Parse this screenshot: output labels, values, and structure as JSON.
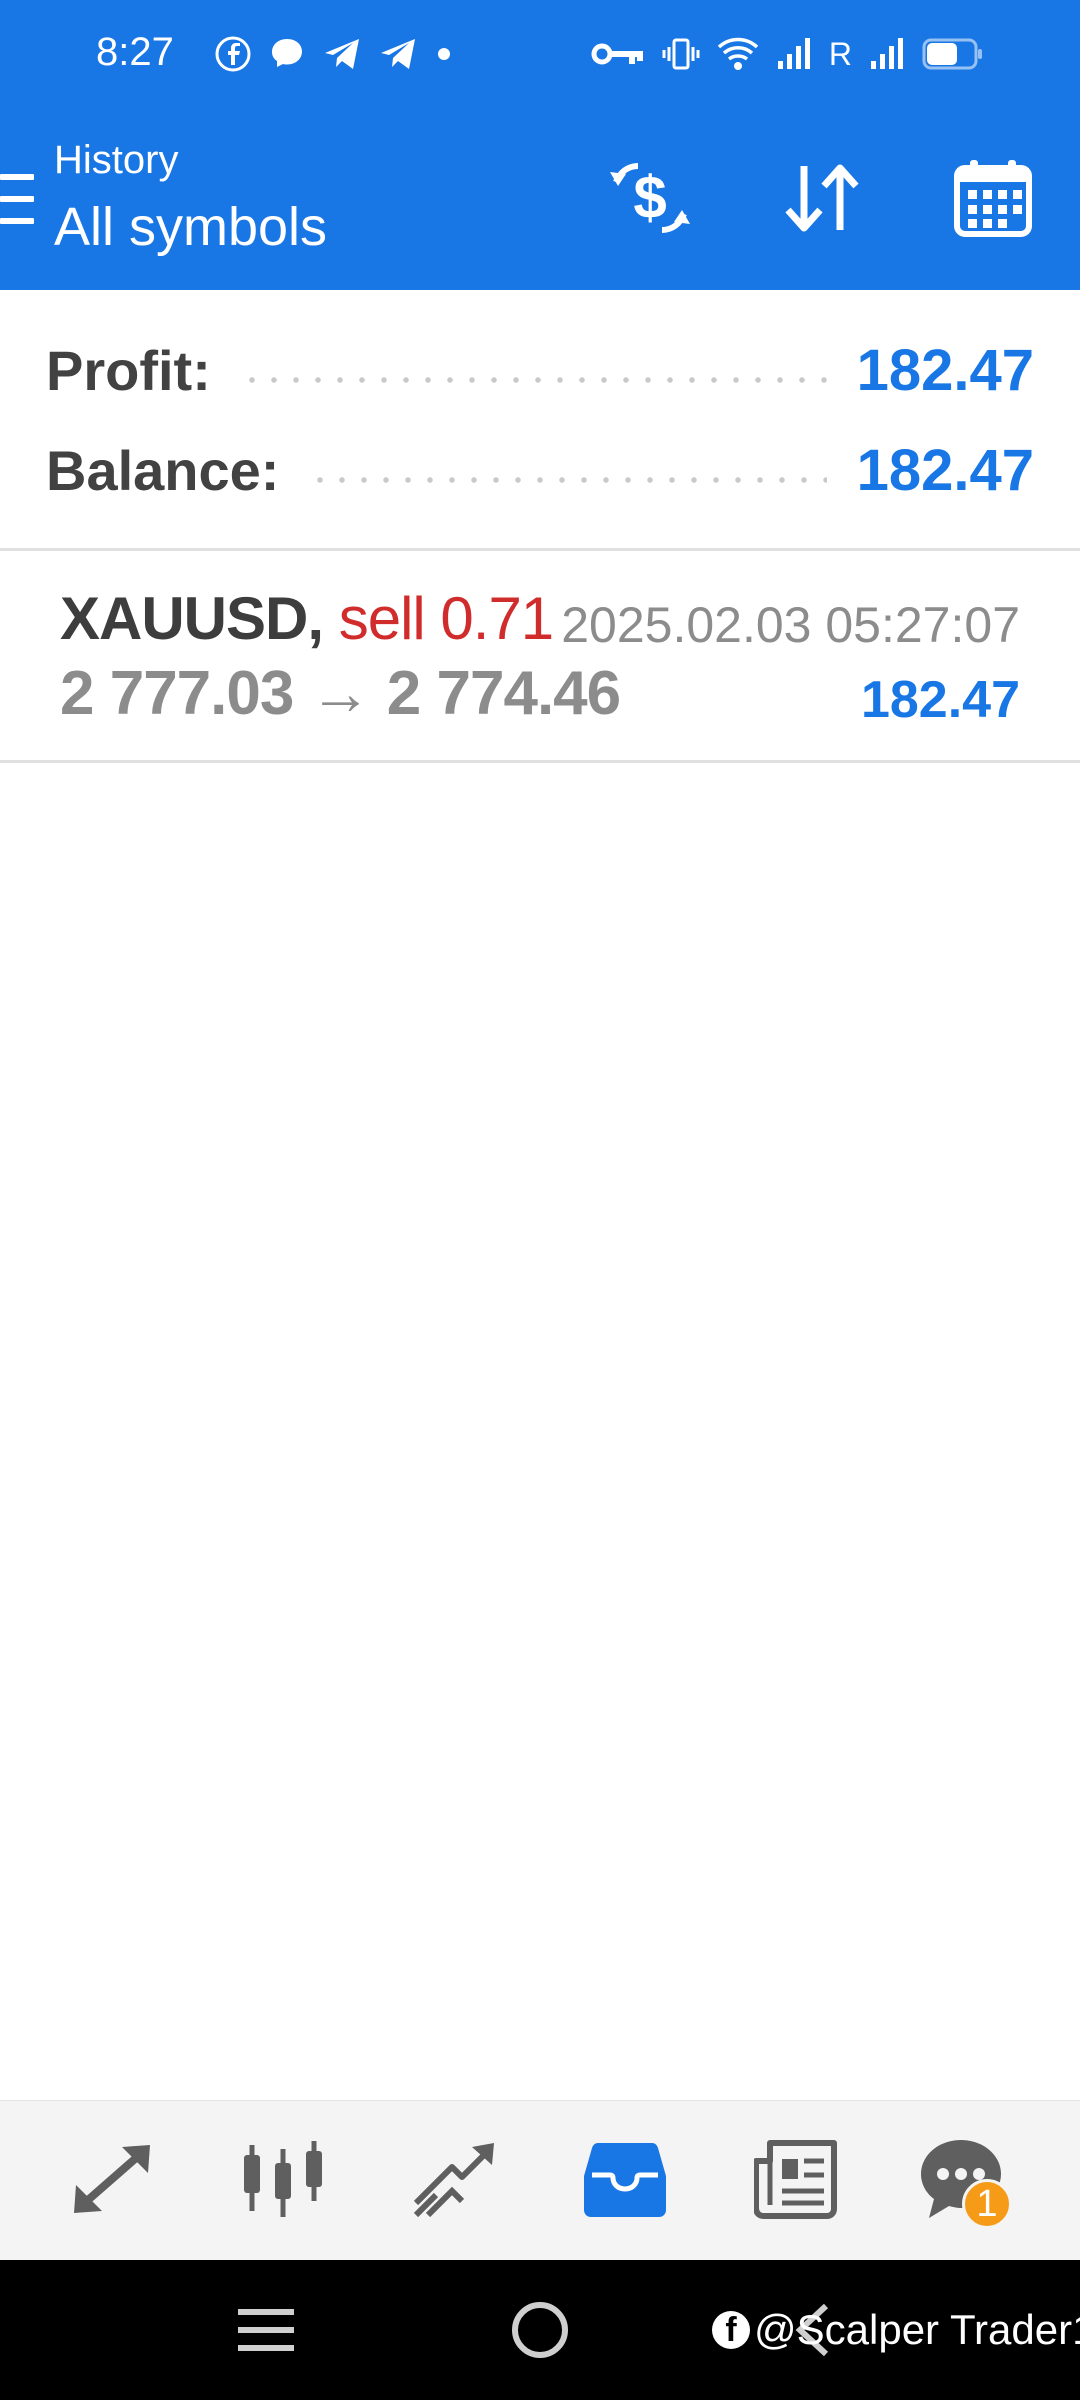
{
  "status_bar": {
    "time": "8:27",
    "carrier_label": "R",
    "left_icons": [
      "facebook-icon",
      "messenger-icon",
      "telegram-icon",
      "telegram-icon",
      "dot-icon"
    ],
    "right_icons": [
      "vpn-key-icon",
      "vibrate-icon",
      "wifi-icon",
      "signal-icon",
      "signal-icon",
      "battery-icon"
    ]
  },
  "toolbar": {
    "title": "History",
    "subtitle": "All symbols",
    "actions": [
      "currency-exchange-icon",
      "sort-icon",
      "calendar-icon"
    ]
  },
  "summary": {
    "profit_label": "Profit:",
    "profit_value": "182.47",
    "balance_label": "Balance:",
    "balance_value": "182.47"
  },
  "deals": [
    {
      "symbol": "XAUUSD,",
      "type": "sell 0.71",
      "datetime": "2025.02.03 05:27:07",
      "prices": "2 777.03 → 2 774.46",
      "profit": "182.47"
    }
  ],
  "tabs": [
    {
      "icon": "quotes-arrows-icon",
      "active": false
    },
    {
      "icon": "candlestick-chart-icon",
      "active": false
    },
    {
      "icon": "trade-chart-icon",
      "active": false
    },
    {
      "icon": "history-inbox-icon",
      "active": true
    },
    {
      "icon": "news-icon",
      "active": false
    },
    {
      "icon": "messages-icon",
      "active": false,
      "badge": "1"
    }
  ],
  "watermark": {
    "fb_letter": "f",
    "text": "@Scalper Trader1"
  },
  "colors": {
    "accent": "#1976e5",
    "sell": "#d12c2c",
    "badge": "#f59b18",
    "muted_text": "#8c8c8c"
  }
}
